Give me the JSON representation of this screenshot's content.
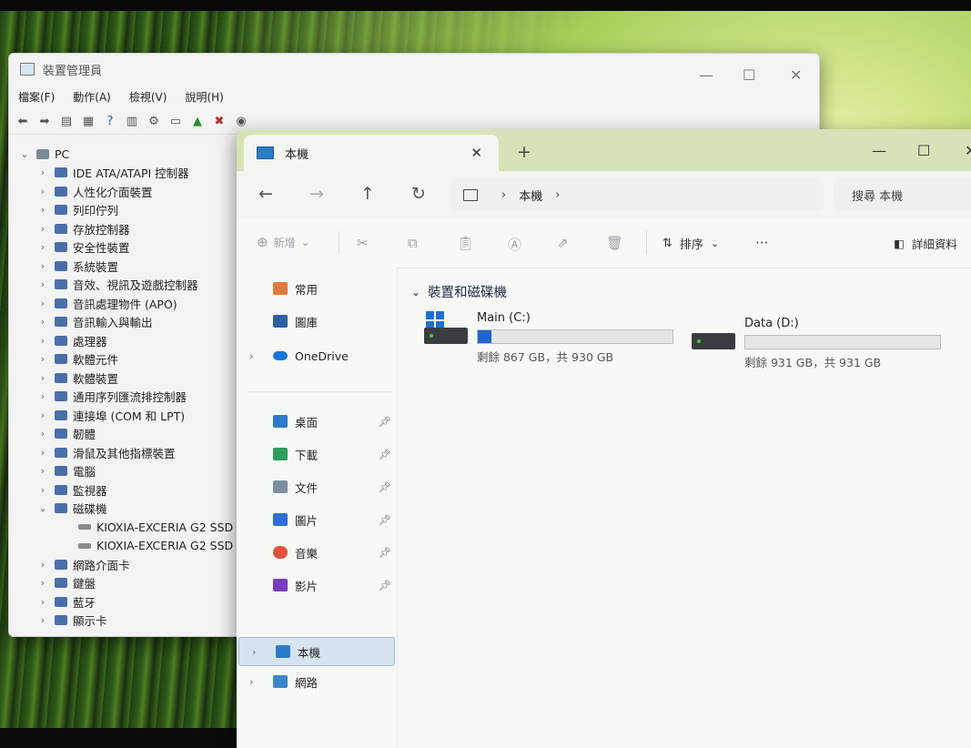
{
  "colors": {
    "accent": "#1e66c8",
    "titlebar_tint": "#d6e3b8",
    "selection": "#d7e3ee"
  },
  "device_manager": {
    "title": "裝置管理員",
    "menu": [
      "檔案(F)",
      "動作(A)",
      "檢視(V)",
      "說明(H)"
    ],
    "tree": {
      "root": "PC",
      "categories": [
        {
          "label": "IDE ATA/ATAPI 控制器",
          "expanded": false
        },
        {
          "label": "人性化介面裝置",
          "expanded": false
        },
        {
          "label": "列印佇列",
          "expanded": false
        },
        {
          "label": "存放控制器",
          "expanded": false
        },
        {
          "label": "安全性裝置",
          "expanded": false
        },
        {
          "label": "系統裝置",
          "expanded": false
        },
        {
          "label": "音效、視訊及遊戲控制器",
          "expanded": false
        },
        {
          "label": "音訊處理物件 (APO)",
          "expanded": false
        },
        {
          "label": "音訊輸入與輸出",
          "expanded": false
        },
        {
          "label": "處理器",
          "expanded": false
        },
        {
          "label": "軟體元件",
          "expanded": false
        },
        {
          "label": "軟體裝置",
          "expanded": false
        },
        {
          "label": "通用序列匯流排控制器",
          "expanded": false
        },
        {
          "label": "連接埠 (COM 和 LPT)",
          "expanded": false
        },
        {
          "label": "韌體",
          "expanded": false
        },
        {
          "label": "滑鼠及其他指標裝置",
          "expanded": false
        },
        {
          "label": "電腦",
          "expanded": false
        },
        {
          "label": "監視器",
          "expanded": false
        },
        {
          "label": "磁碟機",
          "expanded": true
        }
      ],
      "disk_devices": [
        "KIOXIA-EXCERIA G2 SSD",
        "KIOXIA-EXCERIA G2 SSD"
      ],
      "categories_after": [
        {
          "label": "網路介面卡"
        },
        {
          "label": "鍵盤"
        },
        {
          "label": "藍牙"
        },
        {
          "label": "顯示卡"
        }
      ]
    }
  },
  "explorer": {
    "tab_title": "本機",
    "new_tab": "+",
    "address": {
      "location": "本機"
    },
    "search_placeholder": "搜尋 本機",
    "commands": {
      "new": "新增",
      "sort": "排序",
      "more": "···",
      "details": "詳細資料"
    },
    "sidebar": {
      "top": [
        {
          "label": "常用",
          "icon": "home-icon"
        },
        {
          "label": "圖庫",
          "icon": "gallery-icon"
        },
        {
          "label": "OneDrive",
          "icon": "cloud-icon"
        }
      ],
      "pinned": [
        {
          "label": "桌面",
          "icon": "desktop-icon"
        },
        {
          "label": "下載",
          "icon": "download-icon"
        },
        {
          "label": "文件",
          "icon": "documents-icon"
        },
        {
          "label": "圖片",
          "icon": "pictures-icon"
        },
        {
          "label": "音樂",
          "icon": "music-icon"
        },
        {
          "label": "影片",
          "icon": "videos-icon"
        }
      ],
      "bottom": [
        {
          "label": "本機",
          "icon": "this-pc-icon",
          "selected": true
        },
        {
          "label": "網路",
          "icon": "network-icon"
        }
      ]
    },
    "group_header": "裝置和磁碟機",
    "drives": [
      {
        "name": "Main (C:)",
        "free_text": "剩餘 867 GB，共 930 GB",
        "used_fraction": 0.068,
        "system": true
      },
      {
        "name": "Data (D:)",
        "free_text": "剩餘 931 GB，共 931 GB",
        "used_fraction": 0.0,
        "system": false
      }
    ]
  }
}
